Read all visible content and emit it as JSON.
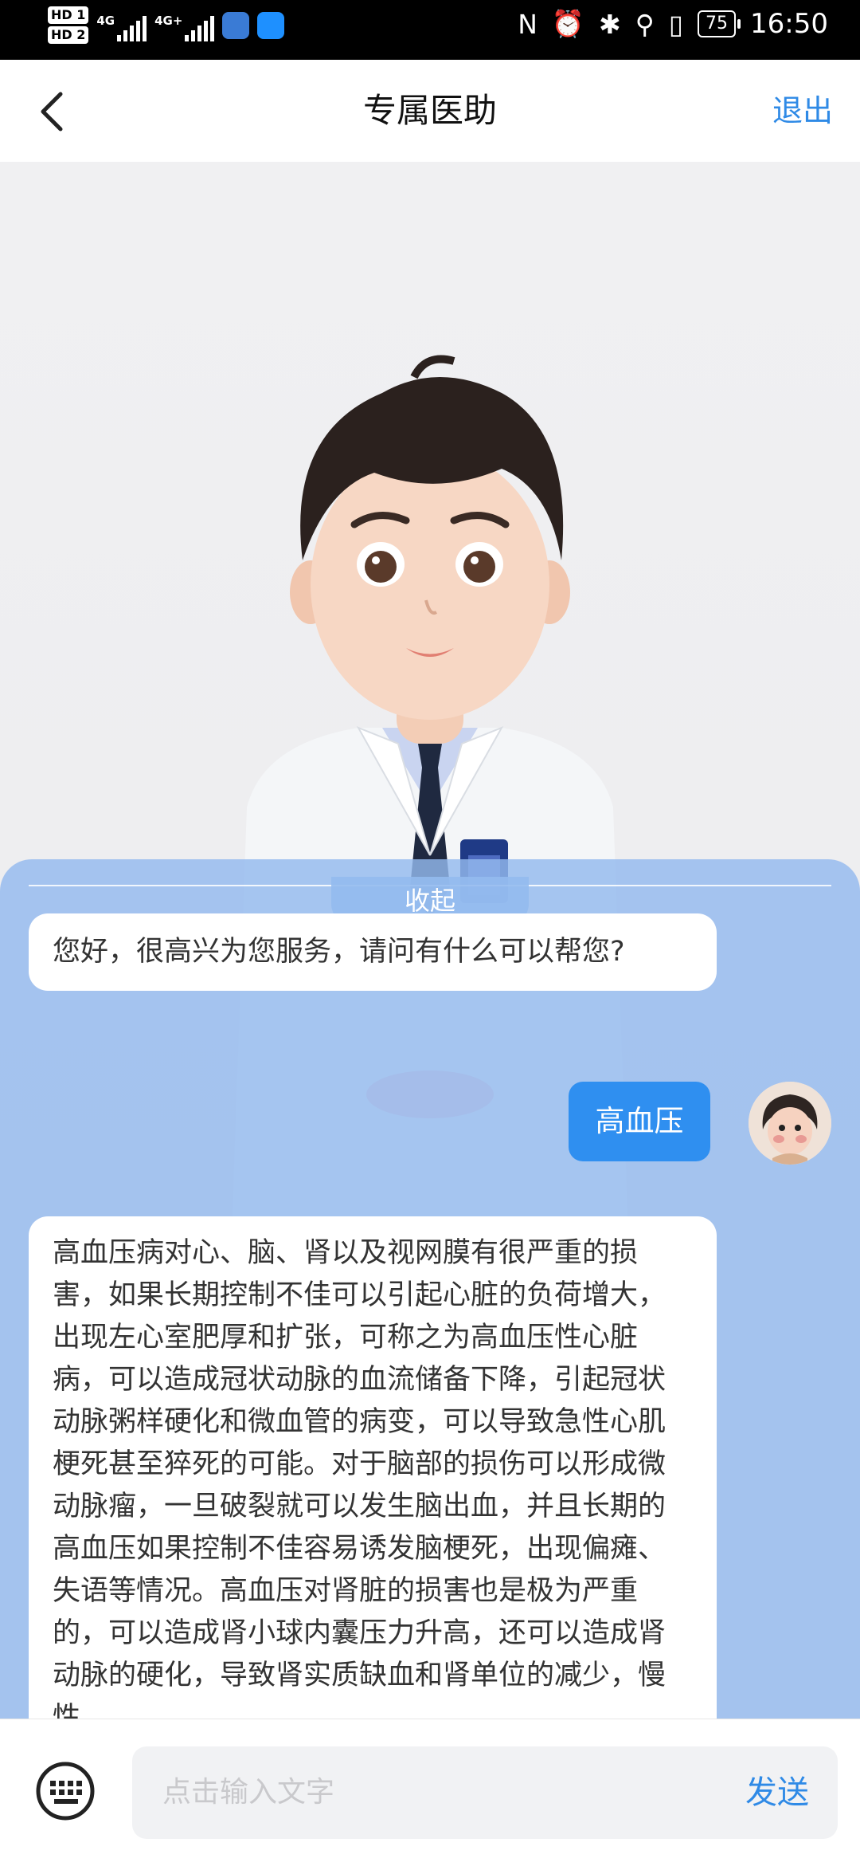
{
  "status_bar": {
    "sim1": "HD 1",
    "sim2": "HD 2",
    "network1": "4G",
    "network2": "4G+",
    "battery": "75",
    "time": "16:50"
  },
  "header": {
    "title": "专属医助",
    "exit_label": "退出"
  },
  "chat": {
    "collapse_label": "收起",
    "messages": [
      {
        "from": "bot",
        "text": "您好，很高兴为您服务，请问有什么可以帮您?"
      },
      {
        "from": "user",
        "text": "高血压"
      },
      {
        "from": "bot",
        "text": "高血压病对心、脑、肾以及视网膜有很严重的损害，如果长期控制不佳可以引起心脏的负荷增大，出现左心室肥厚和扩张，可称之为高血压性心脏病，可以造成冠状动脉的血流储备下降，引起冠状动脉粥样硬化和微血管的病变，可以导致急性心肌梗死甚至猝死的可能。对于脑部的损伤可以形成微动脉瘤，一旦破裂就可以发生脑出血，并且长期的高血压如果控制不佳容易诱发脑梗死，出现偏瘫、失语等情况。高血压对肾脏的损害也是极为严重的，可以造成肾小球内囊压力升高，还可以造成肾动脉的硬化，导致肾实质缺血和肾单位的减少，慢性"
      }
    ]
  },
  "input": {
    "placeholder": "点击输入文字",
    "send_label": "发送"
  },
  "colors": {
    "accent": "#2f8ae6",
    "user_bubble": "#2f8ff0",
    "chat_panel": "#94baee"
  }
}
